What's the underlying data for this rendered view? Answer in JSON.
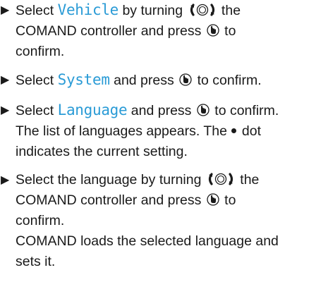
{
  "steps": [
    {
      "line1_a": "Select ",
      "keyword": "Vehicle",
      "line1_b": " by turning ",
      "line1_c": " the",
      "line2_a": "COMAND controller and press ",
      "line2_b": " to",
      "line3": "confirm."
    },
    {
      "a": "Select ",
      "keyword": "System",
      "b": " and press ",
      "c": " to confirm."
    },
    {
      "a": "Select ",
      "keyword": "Language",
      "b": " and press ",
      "c": " to confirm.",
      "line2": "The list of languages appears. The",
      "line2_b": "dot",
      "line3": "indicates the current setting."
    },
    {
      "line1_a": "Select the language by turning ",
      "line1_b": " the",
      "line2_a": "COMAND controller and press ",
      "line2_b": " to",
      "line3": "confirm.",
      "line4": "COMAND loads the selected language and",
      "line5": "sets it."
    }
  ],
  "icons": {
    "bullet": "arrow-right-icon",
    "turn": "controller-turn-icon",
    "press": "controller-press-icon",
    "current": "bullet-dot-icon"
  },
  "colors": {
    "text": "#1a1a1a",
    "keyword": "#2a9bd6"
  }
}
